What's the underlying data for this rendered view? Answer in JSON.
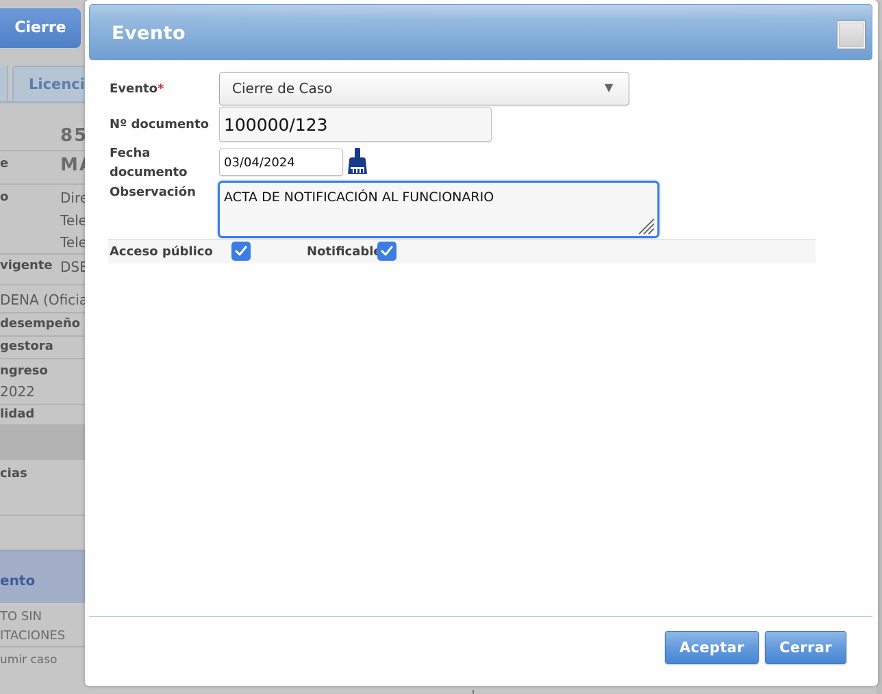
{
  "background": {
    "top_button": "Cierre",
    "tab_label": "Licencias",
    "rows": [
      {
        "label": "",
        "value": "85"
      },
      {
        "label": "e",
        "value": "MA"
      },
      {
        "label": "o",
        "value": "Dire"
      },
      {
        "label": "",
        "value": "Tele"
      },
      {
        "label": "",
        "value": "Tele"
      },
      {
        "label": "vigente",
        "value": "DSE"
      }
    ],
    "line_oficial": "DENA (Oficial",
    "desempeno": "desempeño",
    "gestora": "gestora",
    "ingreso": "ngreso",
    "year": "2022",
    "lidad": "lidad",
    "cias": "cias",
    "evento_band": "ento",
    "sin_1": "TO SIN",
    "sin_2": "ITACIONES",
    "asumir": "umir caso"
  },
  "dialog": {
    "title": "Evento",
    "fields": {
      "evento": {
        "label": "Evento",
        "required_mark": "*",
        "selected": "Cierre de Caso"
      },
      "documento": {
        "label": "Nº documento",
        "value": "100000/123"
      },
      "fecha": {
        "label_line1": "Fecha",
        "label_line2": "documento",
        "value": "03/04/2024"
      },
      "observacion": {
        "label": "Observación",
        "value": "ACTA DE NOTIFICACIÓN AL FUNCIONARIO"
      }
    },
    "checkboxes": {
      "acceso_publico": {
        "label": "Acceso público",
        "checked": true
      },
      "notificable": {
        "label": "Notificable",
        "checked": true
      }
    },
    "buttons": {
      "accept": "Aceptar",
      "close": "Cerrar"
    }
  },
  "colors": {
    "accent": "#3b7de3",
    "header": "#8cb3dc",
    "required": "#d43030",
    "icon": "#1a3a8c"
  },
  "icons": {
    "close": "square-close-icon",
    "clear_date": "broom-icon",
    "dropdown": "triangle-down-icon",
    "check": "checkmark-icon"
  }
}
